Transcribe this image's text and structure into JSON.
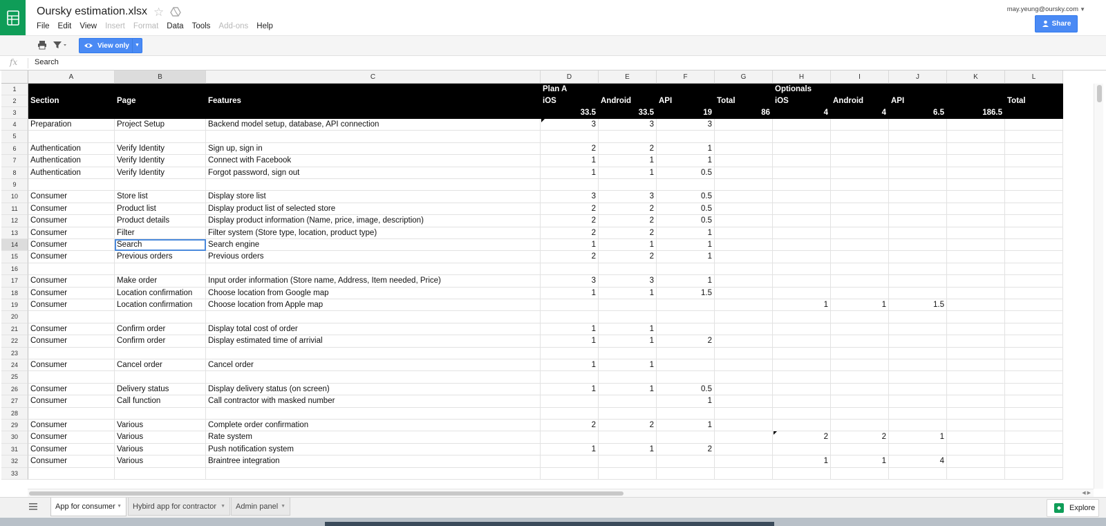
{
  "header": {
    "doc_title": "Oursky estimation.xlsx",
    "menu": [
      {
        "label": "File",
        "disabled": false
      },
      {
        "label": "Edit",
        "disabled": false
      },
      {
        "label": "View",
        "disabled": false
      },
      {
        "label": "Insert",
        "disabled": true
      },
      {
        "label": "Format",
        "disabled": true
      },
      {
        "label": "Data",
        "disabled": false
      },
      {
        "label": "Tools",
        "disabled": false
      },
      {
        "label": "Add-ons",
        "disabled": true
      },
      {
        "label": "Help",
        "disabled": false
      }
    ],
    "user_email": "may.yeung@oursky.com",
    "share_label": "Share",
    "accent": "#4a8af4",
    "brand": "#0f9d58"
  },
  "toolbar": {
    "view_only_label": "View only"
  },
  "formula_bar": {
    "fx_label": "fx",
    "value": "Search"
  },
  "grid": {
    "columns": [
      "A",
      "B",
      "C",
      "D",
      "E",
      "F",
      "G",
      "H",
      "I",
      "J",
      "K",
      "L"
    ],
    "selected_column": "B",
    "selected_row": "14",
    "header_rows": [
      [
        "",
        "",
        "",
        "Plan A",
        "",
        "",
        "",
        "Optionals",
        "",
        "",
        "",
        ""
      ],
      [
        "Section",
        "Page",
        "Features",
        "iOS",
        "Android",
        "API",
        "Total",
        "iOS",
        "Android",
        "API",
        "",
        "Total"
      ],
      [
        "",
        "",
        "",
        "33.5",
        "33.5",
        "19",
        "86",
        "4",
        "4",
        "6.5",
        "186.5",
        ""
      ]
    ],
    "data_rows": [
      {
        "row": "4",
        "cells": [
          "Preparation",
          "Project Setup",
          "Backend model setup, database, API connection",
          "3",
          "3",
          "3",
          "",
          "",
          "",
          "",
          "",
          ""
        ]
      },
      {
        "row": "5",
        "cells": [
          "",
          "",
          "",
          "",
          "",
          "",
          "",
          "",
          "",
          "",
          "",
          ""
        ]
      },
      {
        "row": "6",
        "cells": [
          "Authentication",
          "Verify Identity",
          "Sign up, sign in",
          "2",
          "2",
          "1",
          "",
          "",
          "",
          "",
          "",
          ""
        ]
      },
      {
        "row": "7",
        "cells": [
          "Authentication",
          "Verify Identity",
          "Connect with Facebook",
          "1",
          "1",
          "1",
          "",
          "",
          "",
          "",
          "",
          ""
        ]
      },
      {
        "row": "8",
        "cells": [
          "Authentication",
          "Verify Identity",
          "Forgot password, sign out",
          "1",
          "1",
          "0.5",
          "",
          "",
          "",
          "",
          "",
          ""
        ]
      },
      {
        "row": "9",
        "cells": [
          "",
          "",
          "",
          "",
          "",
          "",
          "",
          "",
          "",
          "",
          "",
          ""
        ]
      },
      {
        "row": "10",
        "cells": [
          "Consumer",
          "Store list",
          "Display store list",
          "3",
          "3",
          "0.5",
          "",
          "",
          "",
          "",
          "",
          ""
        ]
      },
      {
        "row": "11",
        "cells": [
          "Consumer",
          "Product list",
          "Display product list of selected store",
          "2",
          "2",
          "0.5",
          "",
          "",
          "",
          "",
          "",
          ""
        ]
      },
      {
        "row": "12",
        "cells": [
          "Consumer",
          "Product details",
          "Display product information (Name, price, image, description)",
          "2",
          "2",
          "0.5",
          "",
          "",
          "",
          "",
          "",
          ""
        ]
      },
      {
        "row": "13",
        "cells": [
          "Consumer",
          "Filter",
          "Filter system (Store type, location, product type)",
          "2",
          "2",
          "1",
          "",
          "",
          "",
          "",
          "",
          ""
        ]
      },
      {
        "row": "14",
        "cells": [
          "Consumer",
          "Search",
          "Search engine",
          "1",
          "1",
          "1",
          "",
          "",
          "",
          "",
          "",
          ""
        ]
      },
      {
        "row": "15",
        "cells": [
          "Consumer",
          "Previous orders",
          "Previous orders",
          "2",
          "2",
          "1",
          "",
          "",
          "",
          "",
          "",
          ""
        ]
      },
      {
        "row": "16",
        "cells": [
          "",
          "",
          "",
          "",
          "",
          "",
          "",
          "",
          "",
          "",
          "",
          ""
        ]
      },
      {
        "row": "17",
        "cells": [
          "Consumer",
          "Make order",
          "Input order information (Store name, Address, Item needed, Price)",
          "3",
          "3",
          "1",
          "",
          "",
          "",
          "",
          "",
          ""
        ]
      },
      {
        "row": "18",
        "cells": [
          "Consumer",
          "Location confirmation",
          "Choose location from Google map",
          "1",
          "1",
          "1.5",
          "",
          "",
          "",
          "",
          "",
          ""
        ]
      },
      {
        "row": "19",
        "cells": [
          "Consumer",
          "Location confirmation",
          "Choose location from Apple map",
          "",
          "",
          "",
          "",
          "1",
          "1",
          "1.5",
          "",
          ""
        ]
      },
      {
        "row": "20",
        "cells": [
          "",
          "",
          "",
          "",
          "",
          "",
          "",
          "",
          "",
          "",
          "",
          ""
        ]
      },
      {
        "row": "21",
        "cells": [
          "Consumer",
          "Confirm order",
          "Display total cost of order",
          "1",
          "1",
          "",
          "",
          "",
          "",
          "",
          "",
          ""
        ]
      },
      {
        "row": "22",
        "cells": [
          "Consumer",
          "Confirm order",
          "Display estimated time of arrivial",
          "1",
          "1",
          "2",
          "",
          "",
          "",
          "",
          "",
          ""
        ]
      },
      {
        "row": "23",
        "cells": [
          "",
          "",
          "",
          "",
          "",
          "",
          "",
          "",
          "",
          "",
          "",
          ""
        ]
      },
      {
        "row": "24",
        "cells": [
          "Consumer",
          "Cancel order",
          "Cancel order",
          "1",
          "1",
          "",
          "",
          "",
          "",
          "",
          "",
          ""
        ]
      },
      {
        "row": "25",
        "cells": [
          "",
          "",
          "",
          "",
          "",
          "",
          "",
          "",
          "",
          "",
          "",
          ""
        ]
      },
      {
        "row": "26",
        "cells": [
          "Consumer",
          "Delivery status",
          "Display delivery status (on screen)",
          "1",
          "1",
          "0.5",
          "",
          "",
          "",
          "",
          "",
          ""
        ]
      },
      {
        "row": "27",
        "cells": [
          "Consumer",
          "Call function",
          "Call contractor with masked number",
          "",
          "",
          "1",
          "",
          "",
          "",
          "",
          "",
          ""
        ]
      },
      {
        "row": "28",
        "cells": [
          "",
          "",
          "",
          "",
          "",
          "",
          "",
          "",
          "",
          "",
          "",
          ""
        ]
      },
      {
        "row": "29",
        "cells": [
          "Consumer",
          "Various",
          "Complete order confirmation",
          "2",
          "2",
          "1",
          "",
          "",
          "",
          "",
          "",
          ""
        ]
      },
      {
        "row": "30",
        "cells": [
          "Consumer",
          "Various",
          "Rate system",
          "",
          "",
          "",
          "",
          "2",
          "2",
          "1",
          "",
          ""
        ]
      },
      {
        "row": "31",
        "cells": [
          "Consumer",
          "Various",
          "Push notification system",
          "1",
          "1",
          "2",
          "",
          "",
          "",
          "",
          "",
          ""
        ]
      },
      {
        "row": "32",
        "cells": [
          "Consumer",
          "Various",
          "Braintree integration",
          "",
          "",
          "",
          "",
          "1",
          "1",
          "4",
          "",
          ""
        ]
      },
      {
        "row": "33",
        "cells": [
          "",
          "",
          "",
          "",
          "",
          "",
          "",
          "",
          "",
          "",
          "",
          ""
        ]
      }
    ]
  },
  "sheets": {
    "tabs": [
      {
        "label": "App for consumer",
        "active": true
      },
      {
        "label": "Hybird app for contractor",
        "active": false
      },
      {
        "label": "Admin panel",
        "active": false
      }
    ],
    "explore_label": "Explore"
  }
}
